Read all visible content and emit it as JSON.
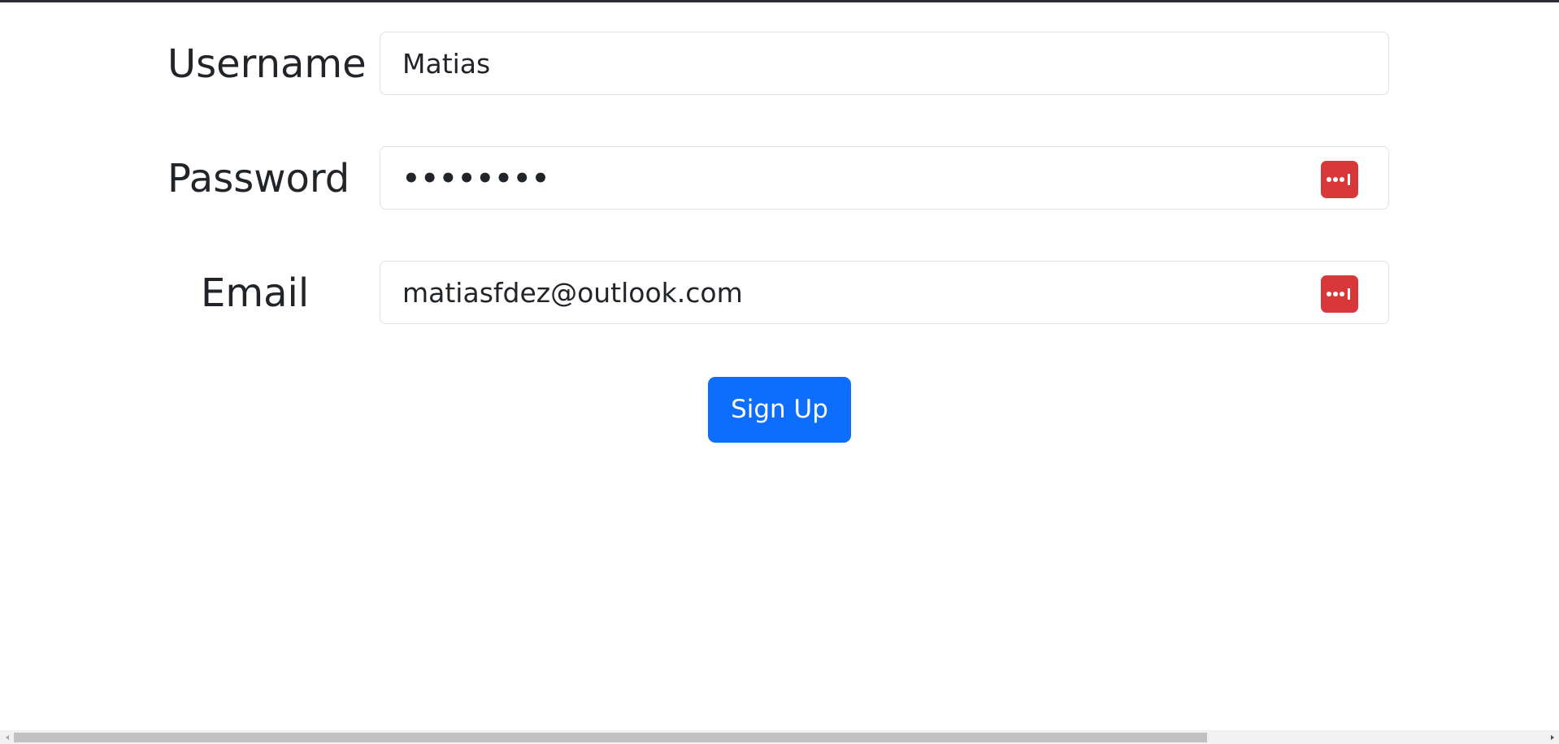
{
  "form": {
    "username": {
      "label": "Username",
      "value": "Matias"
    },
    "password": {
      "label": "Password",
      "value": "••••••••",
      "manager_icon": "password-manager-icon"
    },
    "email": {
      "label": "Email",
      "value": "matiasfdez@outlook.com",
      "manager_icon": "password-manager-icon"
    },
    "submit_label": "Sign Up"
  },
  "colors": {
    "primary": "#0d6efd",
    "password_manager": "#d9383a",
    "text": "#212529",
    "border": "#dee2e6"
  },
  "scrollbar": {
    "left_arrow_icon": "left-arrow-icon",
    "right_arrow_icon": "right-arrow-icon"
  }
}
